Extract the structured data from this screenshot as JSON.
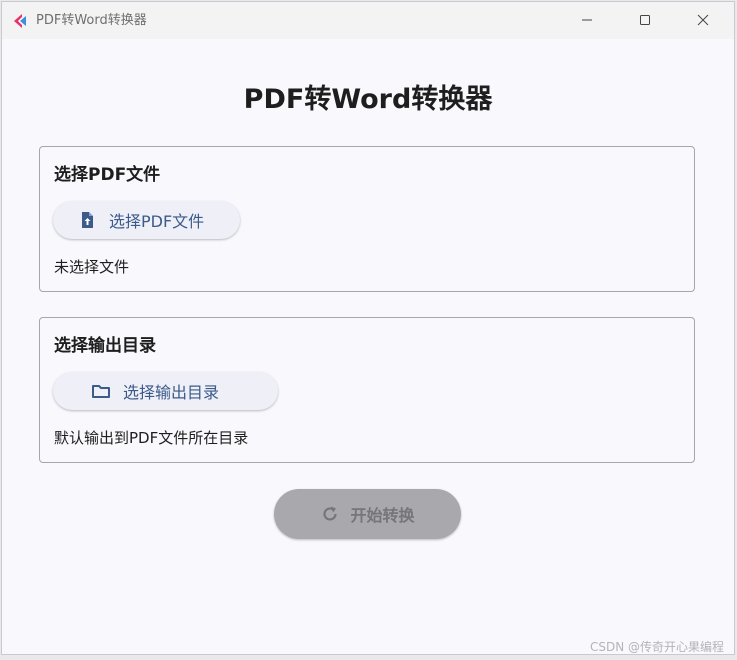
{
  "window": {
    "title": "PDF转Word转换器",
    "icons": {
      "app": "app-logo-icon",
      "minimize": "minimize-icon",
      "maximize": "maximize-icon",
      "close": "close-icon"
    }
  },
  "main": {
    "heading": "PDF转Word转换器"
  },
  "pdf_section": {
    "title": "选择PDF文件",
    "button_label": "选择PDF文件",
    "button_icon": "file-upload-icon",
    "status": "未选择文件"
  },
  "output_section": {
    "title": "选择输出目录",
    "button_label": "选择输出目录",
    "button_icon": "folder-icon",
    "status": "默认输出到PDF文件所在目录"
  },
  "start_button": {
    "label": "开始转换",
    "icon": "refresh-icon",
    "state": "disabled"
  },
  "watermark": "CSDN @传奇开心果编程",
  "colors": {
    "window_bg": "#f8f8fd",
    "titlebar_bg": "#f3f3f3",
    "accent_text": "#3c5a8a",
    "disabled_button": "#a9a9ad",
    "card_border": "#a6a6ab"
  }
}
